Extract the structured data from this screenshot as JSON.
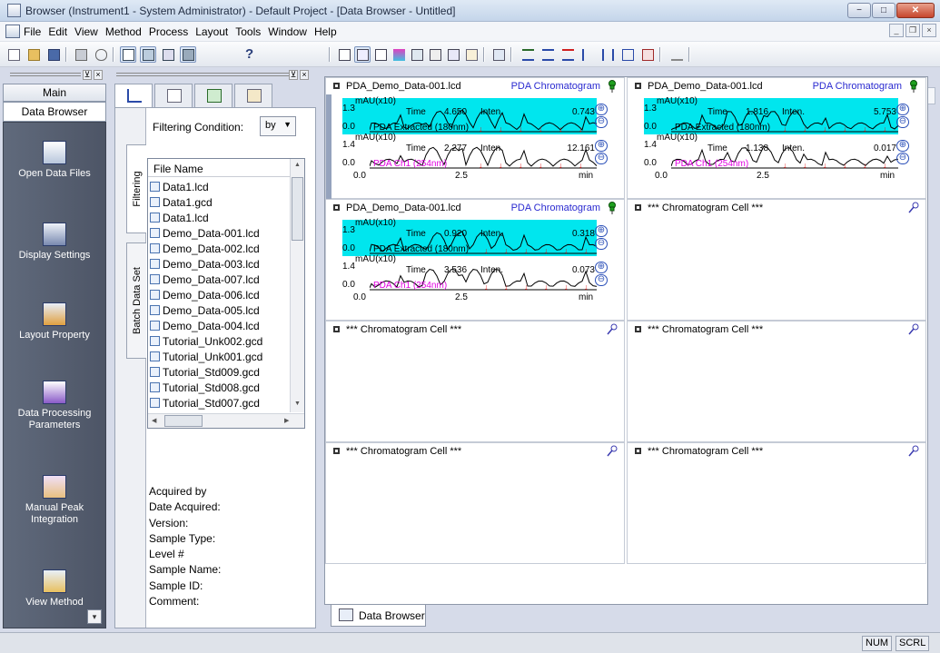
{
  "window": {
    "title": "Browser (Instrument1 - System Administrator) - Default Project - [Data Browser - Untitled]",
    "controls": {
      "minimize": "−",
      "maximize": "□",
      "close": "✕"
    }
  },
  "menu": {
    "items": [
      "File",
      "Edit",
      "View",
      "Method",
      "Process",
      "Layout",
      "Tools",
      "Window",
      "Help"
    ],
    "mdi_controls": {
      "minimize": "_",
      "restore": "❐",
      "close": "×"
    }
  },
  "toolbar": {
    "help_label": "?"
  },
  "left_panel": {
    "grip_close": "×",
    "grip_pin": "⊻",
    "header": "Main",
    "section": "Data Browser",
    "nav": [
      "Open Data Files",
      "Display Settings",
      "Layout Property",
      "Data Processing Parameters",
      "Manual Peak Integration",
      "View Method"
    ],
    "dropdown_arrow": "▾"
  },
  "middle_panel": {
    "vertical_tabs": [
      "Filtering",
      "Batch Data Set"
    ],
    "filter_label": "Filtering Condition:",
    "filter_value": "by",
    "file_header": "File Name",
    "files": [
      "Data1.lcd",
      "Data1.gcd",
      "Data1.lcd",
      "Demo_Data-001.lcd",
      "Demo_Data-002.lcd",
      "Demo_Data-003.lcd",
      "Demo_Data-007.lcd",
      "Demo_Data-006.lcd",
      "Demo_Data-005.lcd",
      "Demo_Data-004.lcd",
      "Tutorial_Unk002.gcd",
      "Tutorial_Unk001.gcd",
      "Tutorial_Std009.gcd",
      "Tutorial_Std008.gcd",
      "Tutorial_Std007.gcd"
    ],
    "meta_labels": [
      "Acquired by",
      "Date Acquired:",
      "Version:",
      "Sample Type:",
      "Level #",
      "Sample Name:",
      "Sample ID:",
      "Comment:"
    ]
  },
  "cells": [
    {
      "file": "PDA_Demo_Data-001.lcd",
      "type": "PDA Chromatogram",
      "unit1": "mAU(x10)",
      "unit2": "mAU(x10)",
      "y1_top": "1.3",
      "y1_bot": "0.0",
      "y2_top": "1.4",
      "y2_bot": "0.0",
      "time1": "4.650",
      "inten1": "0.743",
      "time2": "2.277",
      "inten2": "12.161",
      "trace1": "PDA Extracted (180nm)",
      "trace2": "PDA Ch1 (254nm)",
      "x_ticks": [
        "0.0",
        "2.5",
        "min"
      ]
    },
    {
      "file": "PDA_Demo_Data-001.lcd",
      "type": "PDA Chromatogram",
      "unit1": "mAU(x10)",
      "unit2": "mAU(x10)",
      "y1_top": "1.3",
      "y1_bot": "0.0",
      "y2_top": "1.4",
      "y2_bot": "0.0",
      "time1": "1.816",
      "inten1": "5.753",
      "time2": "1.138",
      "inten2": "0.017",
      "trace1": "PDA Extracted (180nm)",
      "trace2": "PDA Ch1 (254nm)",
      "x_ticks": [
        "0.0",
        "2.5",
        "min"
      ]
    },
    {
      "file": "PDA_Demo_Data-001.lcd",
      "type": "PDA Chromatogram",
      "unit1": "mAU(x10)",
      "unit2": "mAU(x10)",
      "y1_top": "1.3",
      "y1_bot": "0.0",
      "y2_top": "1.4",
      "y2_bot": "0.0",
      "time1": "0.920",
      "inten1": "0.318",
      "time2": "3.536",
      "inten2": "0.073",
      "trace1": "PDA Extracted (180nm)",
      "trace2": "PDA Ch1 (254nm)",
      "x_ticks": [
        "0.0",
        "2.5",
        "min"
      ]
    }
  ],
  "shared_labels": {
    "time": "Time",
    "inten": "Inten.",
    "zoom_in": "⊕",
    "zoom_out": "⊖"
  },
  "empty_cell_label": "*** Chromatogram Cell ***",
  "bottom_tab": "Data Browser",
  "status": {
    "num": "NUM",
    "scrl": "SCRL"
  },
  "colors": {
    "cyan": "#00e6ee",
    "pink": "#e000e0",
    "red": "#e01010",
    "blue": "#2a2ad0",
    "nav_bg": "#575f70"
  }
}
